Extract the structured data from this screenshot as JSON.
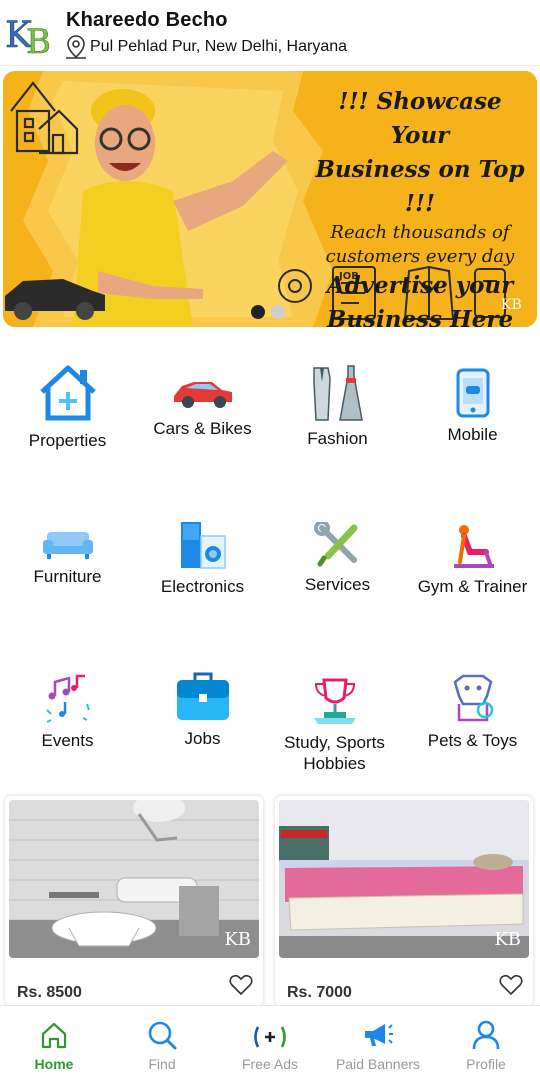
{
  "header": {
    "title": "Khareedo Becho",
    "location": "Pul Pehlad Pur, New Delhi, Haryana",
    "logo_text": "KB"
  },
  "banner": {
    "line1": "!!! Showcase Your",
    "line2": "Business on Top !!!",
    "line3": "Reach thousands of",
    "line4": "customers every day",
    "line5": "Advertise your",
    "line6": "Business Here",
    "job_tag": "JOB",
    "watermark": "KB",
    "active_slide": 1,
    "slide_count": 2
  },
  "categories": [
    {
      "label": "Properties",
      "icon": "house-icon"
    },
    {
      "label": "Cars & Bikes",
      "icon": "car-icon"
    },
    {
      "label": "Fashion",
      "icon": "clothes-icon"
    },
    {
      "label": "Mobile",
      "icon": "phone-icon"
    },
    {
      "label": "Furniture",
      "icon": "sofa-icon"
    },
    {
      "label": "Electronics",
      "icon": "appliances-icon"
    },
    {
      "label": "Services",
      "icon": "tools-icon"
    },
    {
      "label": "Gym & Trainer",
      "icon": "yoga-icon"
    },
    {
      "label": "Events",
      "icon": "music-notes-icon"
    },
    {
      "label": "Jobs",
      "icon": "briefcase-icon"
    },
    {
      "label": "Study, Sports Hobbies",
      "icon": "trophy-icon"
    },
    {
      "label": "Pets & Toys",
      "icon": "pet-icon"
    }
  ],
  "listings": [
    {
      "price": "Rs. 8500",
      "image": "bathroom-photo",
      "watermark": "KB"
    },
    {
      "price": "Rs. 7000",
      "image": "bed-photo",
      "watermark": "KB"
    }
  ],
  "nav": [
    {
      "label": "Home",
      "icon": "home-icon",
      "active": true
    },
    {
      "label": "Find",
      "icon": "search-icon",
      "active": false
    },
    {
      "label": "Free Ads",
      "icon": "add-icon",
      "active": false
    },
    {
      "label": "Paid Banners",
      "icon": "megaphone-icon",
      "active": false
    },
    {
      "label": "Profile",
      "icon": "user-icon",
      "active": false
    }
  ],
  "colors": {
    "accent_blue": "#1e88e5",
    "active_green": "#2e9a2e",
    "banner_yellow": "#f6b21a"
  }
}
